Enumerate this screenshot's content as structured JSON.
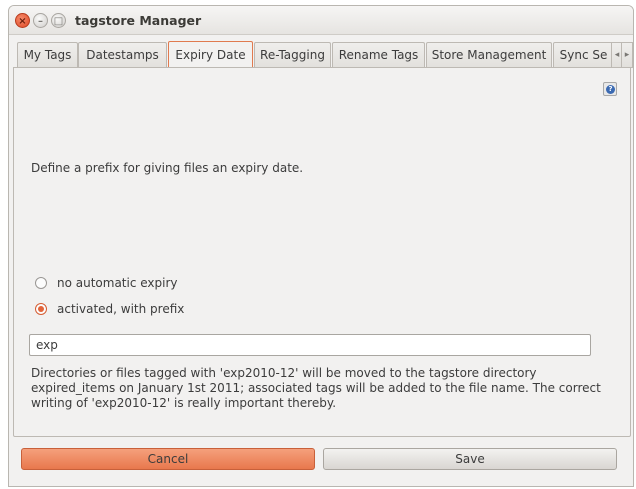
{
  "window": {
    "title": "tagstore Manager",
    "controls": {
      "close": "×",
      "minimize": "–",
      "maximize": "□"
    }
  },
  "tabs": [
    {
      "label": "My Tags"
    },
    {
      "label": "Datestamps"
    },
    {
      "label": "Expiry Date",
      "active": true
    },
    {
      "label": "Re-Tagging"
    },
    {
      "label": "Rename Tags"
    },
    {
      "label": "Store Management"
    },
    {
      "label": "Sync Se"
    }
  ],
  "tab_scroll": {
    "left": "◂",
    "right": "▸"
  },
  "panel": {
    "help_icon": "?",
    "description": "Define a prefix for giving files an expiry date.",
    "options": [
      {
        "label": "no automatic expiry",
        "checked": false
      },
      {
        "label": "activated, with prefix",
        "checked": true
      }
    ],
    "prefix_value": "exp",
    "info_text": "Directories or files tagged with 'exp2010-12' will be moved to the tagstore directory expired_items on January 1st 2011; associated tags will be added to the file name. The correct writing of 'exp2010-12' is really important thereby."
  },
  "buttons": {
    "cancel": "Cancel",
    "save": "Save"
  },
  "colors": {
    "accent": "#e8784d",
    "active_tab_border": "#e07a4f",
    "help_blue": "#3b6ab2"
  }
}
